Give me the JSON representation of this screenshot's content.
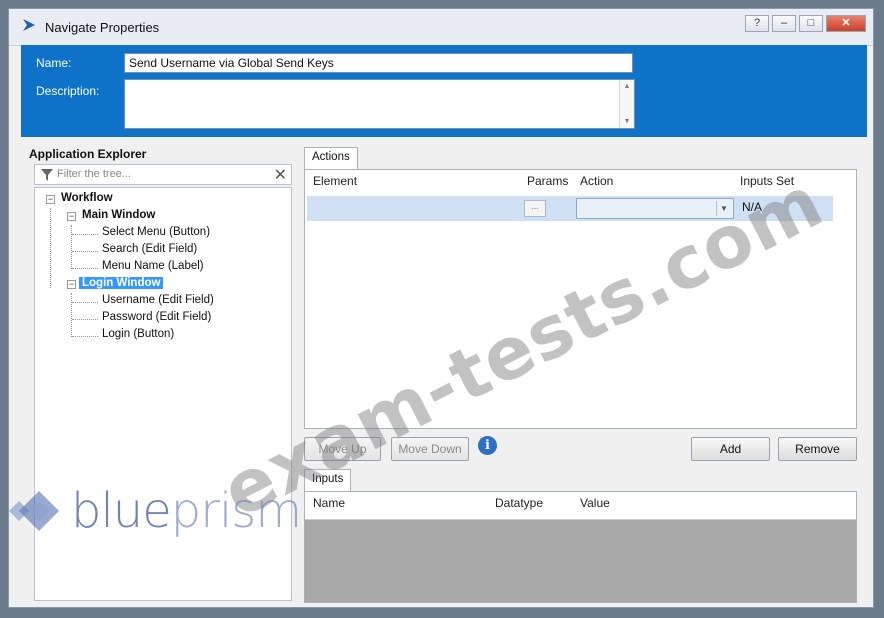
{
  "window": {
    "title": "Navigate Properties",
    "help_label": "?",
    "minimize_label": "–",
    "maximize_label": "□",
    "close_label": "✕"
  },
  "form": {
    "name_label": "Name:",
    "name_value": "Send Username via Global Send Keys",
    "description_label": "Description:",
    "description_value": ""
  },
  "explorer": {
    "title": "Application Explorer",
    "filter_placeholder": "Filter the tree...",
    "tree": {
      "root": "Workflow",
      "main_window": "Main Window",
      "main_children": [
        "Select Menu (Button)",
        "Search (Edit Field)",
        "Menu Name (Label)"
      ],
      "login_window": "Login Window",
      "login_children": [
        "Username (Edit Field)",
        "Password (Edit Field)",
        "Login (Button)"
      ]
    }
  },
  "actions": {
    "tab_label": "Actions",
    "columns": [
      "Element",
      "Params",
      "Action",
      "Inputs Set"
    ],
    "row": {
      "element": "",
      "params": "...",
      "action": "",
      "inputs_set": "N/A"
    },
    "move_up_label": "Move Up",
    "move_down_label": "Move Down",
    "add_label": "Add",
    "remove_label": "Remove"
  },
  "inputs": {
    "tab_label": "Inputs",
    "columns": [
      "Name",
      "Datatype",
      "Value"
    ]
  },
  "watermark": "exam-tests.com",
  "logo": {
    "part1": "blue",
    "part2": "prism"
  },
  "colors": {
    "accent": "#0e73c8",
    "selected": "#3399ff",
    "row_highlight": "#cfe0f5"
  }
}
